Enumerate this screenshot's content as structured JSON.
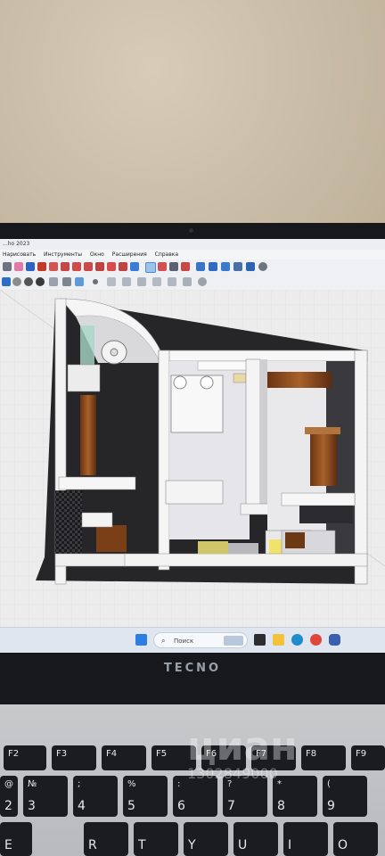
{
  "app": {
    "title": "...ho 2023",
    "menu": [
      "Нарисовать",
      "Инструменты",
      "Окно",
      "Расширения",
      "Справка"
    ]
  },
  "taskbar": {
    "search_placeholder": "Поиск"
  },
  "laptop": {
    "brand": "TECNO"
  },
  "keyboard": {
    "fn_row": [
      "F2",
      "F3",
      "F4",
      "F5",
      "F6",
      "F7",
      "F8",
      "F9"
    ],
    "num_row": [
      {
        "top": "@",
        "bot": "2"
      },
      {
        "top": "№",
        "bot": "3"
      },
      {
        "top": ";",
        "bot": "4"
      },
      {
        "top": "%",
        "bot": "5"
      },
      {
        "top": ":",
        "bot": "6"
      },
      {
        "top": "?",
        "bot": "7"
      },
      {
        "top": "*",
        "bot": "8"
      },
      {
        "top": "(",
        "bot": "9"
      }
    ],
    "letter_row": [
      "E",
      "R",
      "T",
      "Y",
      "U",
      "I",
      "O"
    ]
  },
  "watermark": {
    "text": "циан",
    "id": "1302849000"
  },
  "colors": {
    "accent": "#2f6fd6",
    "wood": "#8a4a1c",
    "floor": "#1f1f22",
    "wall": "#f2f2f2"
  }
}
